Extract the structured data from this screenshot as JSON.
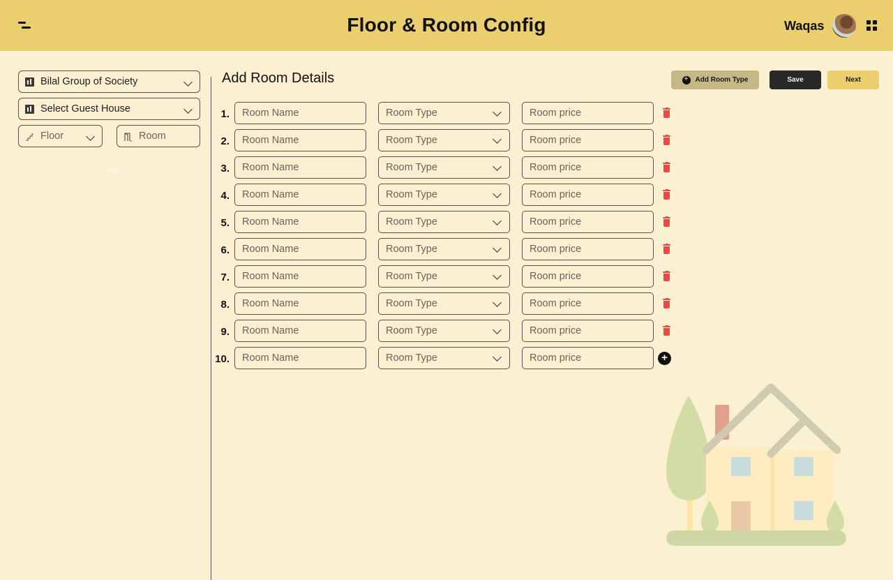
{
  "header": {
    "title": "Floor & Room Config",
    "username": "Waqas",
    "menu_icon": "menu-icon",
    "apps_icon": "grid-icon"
  },
  "sidebar": {
    "society_select": {
      "value": "Bilal Group of Society",
      "icon": "building-icon"
    },
    "guesthouse_select": {
      "value": "Select Guest House",
      "icon": "building-icon"
    },
    "floor_select": {
      "placeholder": "Floor",
      "icon": "stairs-icon"
    },
    "room_input": {
      "placeholder": "Room",
      "icon": "door-icon"
    },
    "add_label": "Add"
  },
  "main": {
    "title": "Add Room Details",
    "buttons": {
      "add_room_type": "Add Room Type",
      "save": "Save",
      "next": "Next"
    },
    "room_rows": [
      {
        "num": "1.",
        "name_placeholder": "Room Name",
        "type_placeholder": "Room Type",
        "price_placeholder": "Room price",
        "action": "delete"
      },
      {
        "num": "2.",
        "name_placeholder": "Room Name",
        "type_placeholder": "Room Type",
        "price_placeholder": "Room price",
        "action": "delete"
      },
      {
        "num": "3.",
        "name_placeholder": "Room Name",
        "type_placeholder": "Room Type",
        "price_placeholder": "Room price",
        "action": "delete"
      },
      {
        "num": "4.",
        "name_placeholder": "Room Name",
        "type_placeholder": "Room Type",
        "price_placeholder": "Room price",
        "action": "delete"
      },
      {
        "num": "5.",
        "name_placeholder": "Room Name",
        "type_placeholder": "Room Type",
        "price_placeholder": "Room price",
        "action": "delete"
      },
      {
        "num": "6.",
        "name_placeholder": "Room Name",
        "type_placeholder": "Room Type",
        "price_placeholder": "Room price",
        "action": "delete"
      },
      {
        "num": "7.",
        "name_placeholder": "Room Name",
        "type_placeholder": "Room Type",
        "price_placeholder": "Room price",
        "action": "delete"
      },
      {
        "num": "8.",
        "name_placeholder": "Room Name",
        "type_placeholder": "Room Type",
        "price_placeholder": "Room price",
        "action": "delete"
      },
      {
        "num": "9.",
        "name_placeholder": "Room Name",
        "type_placeholder": "Room Type",
        "price_placeholder": "Room price",
        "action": "delete"
      },
      {
        "num": "10.",
        "name_placeholder": "Room Name",
        "type_placeholder": "Room Type",
        "price_placeholder": "Room price",
        "action": "add"
      }
    ]
  },
  "colors": {
    "header_bg": "#ebce6e",
    "page_bg": "#fbf0d2",
    "delete_red": "#ea4a45",
    "save_bg": "#282828",
    "add_type_bg": "#c6b886"
  }
}
